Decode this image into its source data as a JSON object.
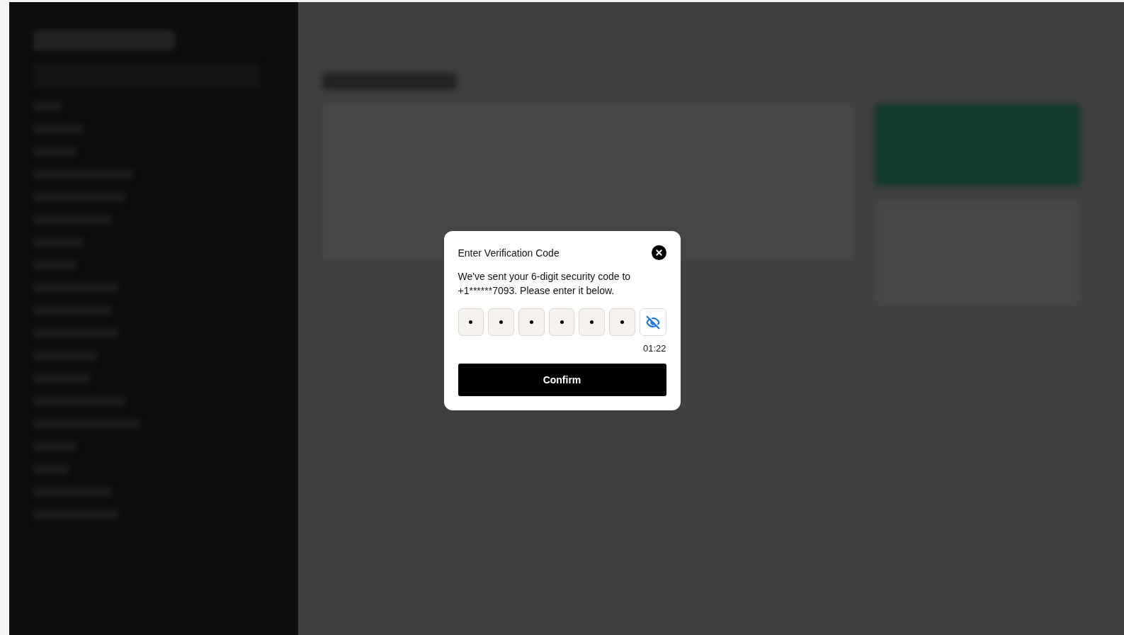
{
  "dialog": {
    "title": "Enter Verification Code",
    "message": "We've sent your 6-digit security code to +1******7093. Please enter it below.",
    "code_boxes": [
      {
        "filled": true
      },
      {
        "filled": true
      },
      {
        "filled": true
      },
      {
        "filled": true
      },
      {
        "filled": true
      },
      {
        "filled": true
      }
    ],
    "code_hidden": true,
    "timer": "01:22",
    "confirm_button": "Confirm"
  }
}
